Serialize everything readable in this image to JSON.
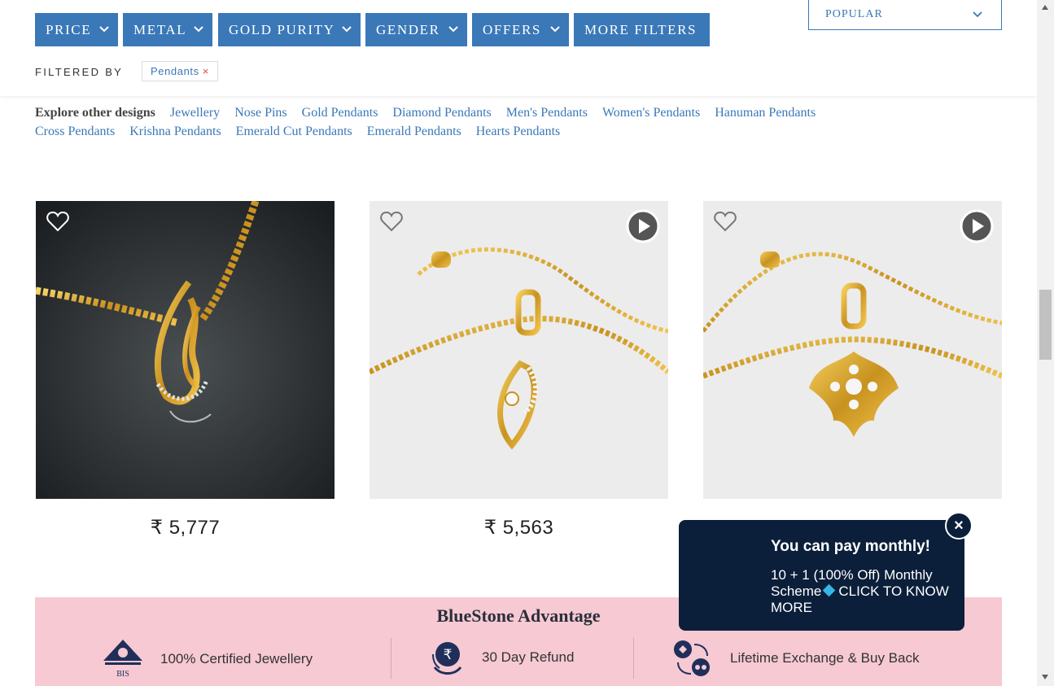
{
  "filters": [
    {
      "label": "PRICE"
    },
    {
      "label": "METAL"
    },
    {
      "label": "GOLD PURITY"
    },
    {
      "label": "GENDER"
    },
    {
      "label": "OFFERS"
    },
    {
      "label": "MORE FILTERS"
    }
  ],
  "sort": {
    "label": "POPULAR"
  },
  "filtered_by": {
    "label": "FILTERED BY",
    "chip": "Pendants",
    "chip_remove": "×"
  },
  "explore": {
    "lead": "Explore other designs",
    "links": [
      "Jewellery",
      "Nose Pins",
      "Gold Pendants",
      "Diamond Pendants",
      "Men's Pendants",
      "Women's Pendants",
      "Hanuman Pendants",
      "Cross Pendants",
      "Krishna Pendants",
      "Emerald Cut Pendants",
      "Emerald Pendants",
      "Hearts Pendants"
    ]
  },
  "products": [
    {
      "price": "₹ 5,777",
      "background": "#2c3033",
      "has_video": false
    },
    {
      "price": "₹ 5,563",
      "background": "#ececec",
      "has_video": true
    },
    {
      "price": "",
      "background": "#ececec",
      "has_video": true
    }
  ],
  "advantage": {
    "title": "BlueStone Advantage",
    "items": [
      {
        "icon": "bis-certification-icon",
        "icon_caption": "BIS",
        "label": "100% Certified Jewellery"
      },
      {
        "icon": "rupee-refund-icon",
        "label": "30 Day Refund"
      },
      {
        "icon": "exchange-icon",
        "label": "Lifetime Exchange & Buy Back"
      }
    ]
  },
  "popup": {
    "title": "You can pay monthly!",
    "body_text": "10 + 1 (100% Off) Monthly Scheme",
    "cta": "CLICK TO KNOW MORE",
    "close": "×"
  },
  "colors": {
    "accent_blue": "#3a78b8",
    "popup_navy": "#0b1f3a",
    "advantage_pink": "#f6c9d3",
    "gold": "#d9a520"
  }
}
